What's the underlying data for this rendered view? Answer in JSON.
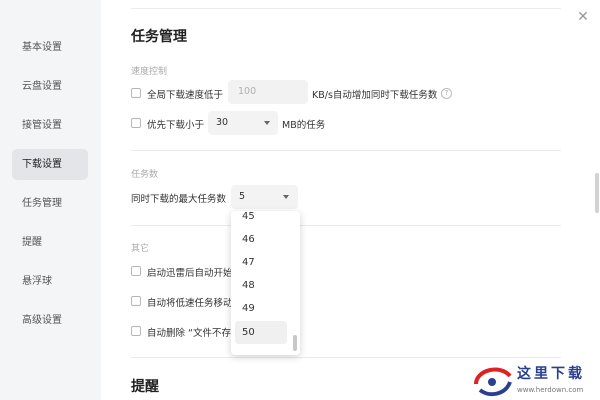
{
  "sidebar": {
    "items": [
      {
        "label": "基本设置"
      },
      {
        "label": "云盘设置"
      },
      {
        "label": "接管设置"
      },
      {
        "label": "下载设置"
      },
      {
        "label": "任务管理"
      },
      {
        "label": "提醒"
      },
      {
        "label": "悬浮球"
      },
      {
        "label": "高级设置"
      }
    ],
    "active": "下载设置"
  },
  "main": {
    "close_icon": "✕",
    "section_title": "任务管理",
    "speed_control": {
      "heading": "速度控制",
      "row1": {
        "label": "全局下载速度低于",
        "input_value": "100",
        "suffix": "KB/s自动增加同时下载任务数",
        "help_icon": "?"
      },
      "row2": {
        "label": "优先下载小于",
        "select_value": "30",
        "suffix": "MB的任务"
      }
    },
    "task_count": {
      "heading": "任务数",
      "label": "同时下载的最大任务数",
      "select_value": "5",
      "dropdown_options": [
        "45",
        "46",
        "47",
        "48",
        "49",
        "50"
      ],
      "hovered_option": "50"
    },
    "other": {
      "heading": "其它",
      "items": [
        {
          "label": "启动迅雷后自动开始"
        },
        {
          "label": "自动将低速任务移动"
        },
        {
          "label": "自动删除 “文件不存"
        }
      ]
    },
    "next_section_title": "提醒"
  },
  "watermark": {
    "text": "这里下载",
    "url": "www.herdown.com"
  }
}
